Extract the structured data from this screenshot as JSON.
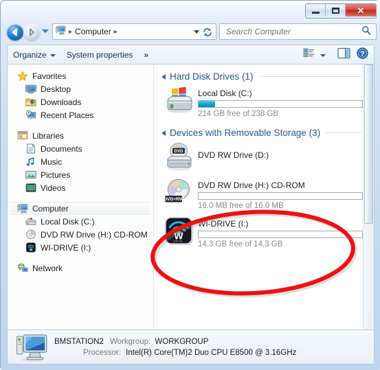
{
  "window": {
    "titlebar_buttons": [
      {
        "name": "minimize",
        "glyph": "—"
      },
      {
        "name": "maximize",
        "glyph": "□"
      },
      {
        "name": "close",
        "glyph": "✕"
      }
    ]
  },
  "addressbar": {
    "back_tooltip": "Back",
    "forward_tooltip": "Forward",
    "breadcrumb": [
      "Computer"
    ],
    "computer_icon": "computer-icon",
    "refresh_glyph": "↻",
    "dropdown_icon": "chevron-down-icon"
  },
  "search": {
    "placeholder": "Search Computer",
    "value": "",
    "icon": "search-icon"
  },
  "toolbar": {
    "organize_label": "Organize",
    "system_properties_label": "System properties",
    "overflow_label": "»",
    "views_icon": "view-list-icon",
    "preview_pane_icon": "preview-pane-icon",
    "help_icon": "help-icon"
  },
  "sidebar": {
    "items": [
      {
        "label": "Favorites",
        "icon": "star-icon",
        "level": 0,
        "selected": false
      },
      {
        "label": "Desktop",
        "icon": "desktop-icon",
        "level": 1,
        "selected": false
      },
      {
        "label": "Downloads",
        "icon": "downloads-icon",
        "level": 1,
        "selected": false
      },
      {
        "label": "Recent Places",
        "icon": "recent-places-icon",
        "level": 1,
        "selected": false
      },
      {
        "label": "__GAP__",
        "icon": "",
        "level": 0,
        "selected": false
      },
      {
        "label": "Libraries",
        "icon": "libraries-icon",
        "level": 0,
        "selected": false
      },
      {
        "label": "Documents",
        "icon": "documents-icon",
        "level": 1,
        "selected": false
      },
      {
        "label": "Music",
        "icon": "music-icon",
        "level": 1,
        "selected": false
      },
      {
        "label": "Pictures",
        "icon": "pictures-icon",
        "level": 1,
        "selected": false
      },
      {
        "label": "Videos",
        "icon": "videos-icon",
        "level": 1,
        "selected": false
      },
      {
        "label": "__GAP__",
        "icon": "",
        "level": 0,
        "selected": false
      },
      {
        "label": "Computer",
        "icon": "computer-icon",
        "level": 0,
        "selected": true
      },
      {
        "label": "Local Disk (C:)",
        "icon": "harddisk-icon",
        "level": 1,
        "selected": false
      },
      {
        "label": "DVD RW Drive (H:) CD-ROM",
        "icon": "dvd-icon",
        "level": 1,
        "selected": false
      },
      {
        "label": "WI-DRIVE (I:)",
        "icon": "widrive-icon",
        "level": 1,
        "selected": false
      },
      {
        "label": "__GAP__",
        "icon": "",
        "level": 0,
        "selected": false
      },
      {
        "label": "Network",
        "icon": "network-icon",
        "level": 0,
        "selected": false
      }
    ]
  },
  "content": {
    "groups": [
      {
        "title": "Hard Disk Drives (1)",
        "items": [
          {
            "name": "Local Disk (C:)",
            "icon": "harddisk-icon",
            "has_bar": true,
            "used_percent": 10,
            "free_text": "214 GB free of 238 GB"
          }
        ]
      },
      {
        "title": "Devices with Removable Storage (3)",
        "items": [
          {
            "name": "DVD RW Drive (D:)",
            "icon": "dvd-rw-icon",
            "has_bar": false,
            "used_percent": 0,
            "free_text": ""
          },
          {
            "name": "DVD RW Drive (H:) CD-ROM",
            "icon": "dvd-plus-rw-icon",
            "has_bar": true,
            "used_percent": 0,
            "free_text": "16.0 MB free of 16.0 MB"
          },
          {
            "name": "WI-DRIVE (I:)",
            "icon": "widrive-icon",
            "has_bar": true,
            "used_percent": 0,
            "free_text": "14.3 GB free of 14.3 GB"
          }
        ]
      }
    ]
  },
  "statusbar": {
    "icon": "computer-large-icon",
    "computer_name": "BMSTATION2",
    "workgroup_label": "Workgroup:",
    "workgroup_value": "WORKGROUP",
    "processor_label": "Processor:",
    "processor_value": "Intel(R) Core(TM)2 Duo CPU    E8500  @ 3.16GHz"
  },
  "annotation": {
    "shape": "ellipse",
    "color": "#ee1111",
    "target": "WI-DRIVE (I:)"
  },
  "colors": {
    "accent_blue": "#25578f",
    "annotation_red": "#ee1111",
    "bar_fill": "#13a7dd",
    "close_red": "#bc2718"
  }
}
